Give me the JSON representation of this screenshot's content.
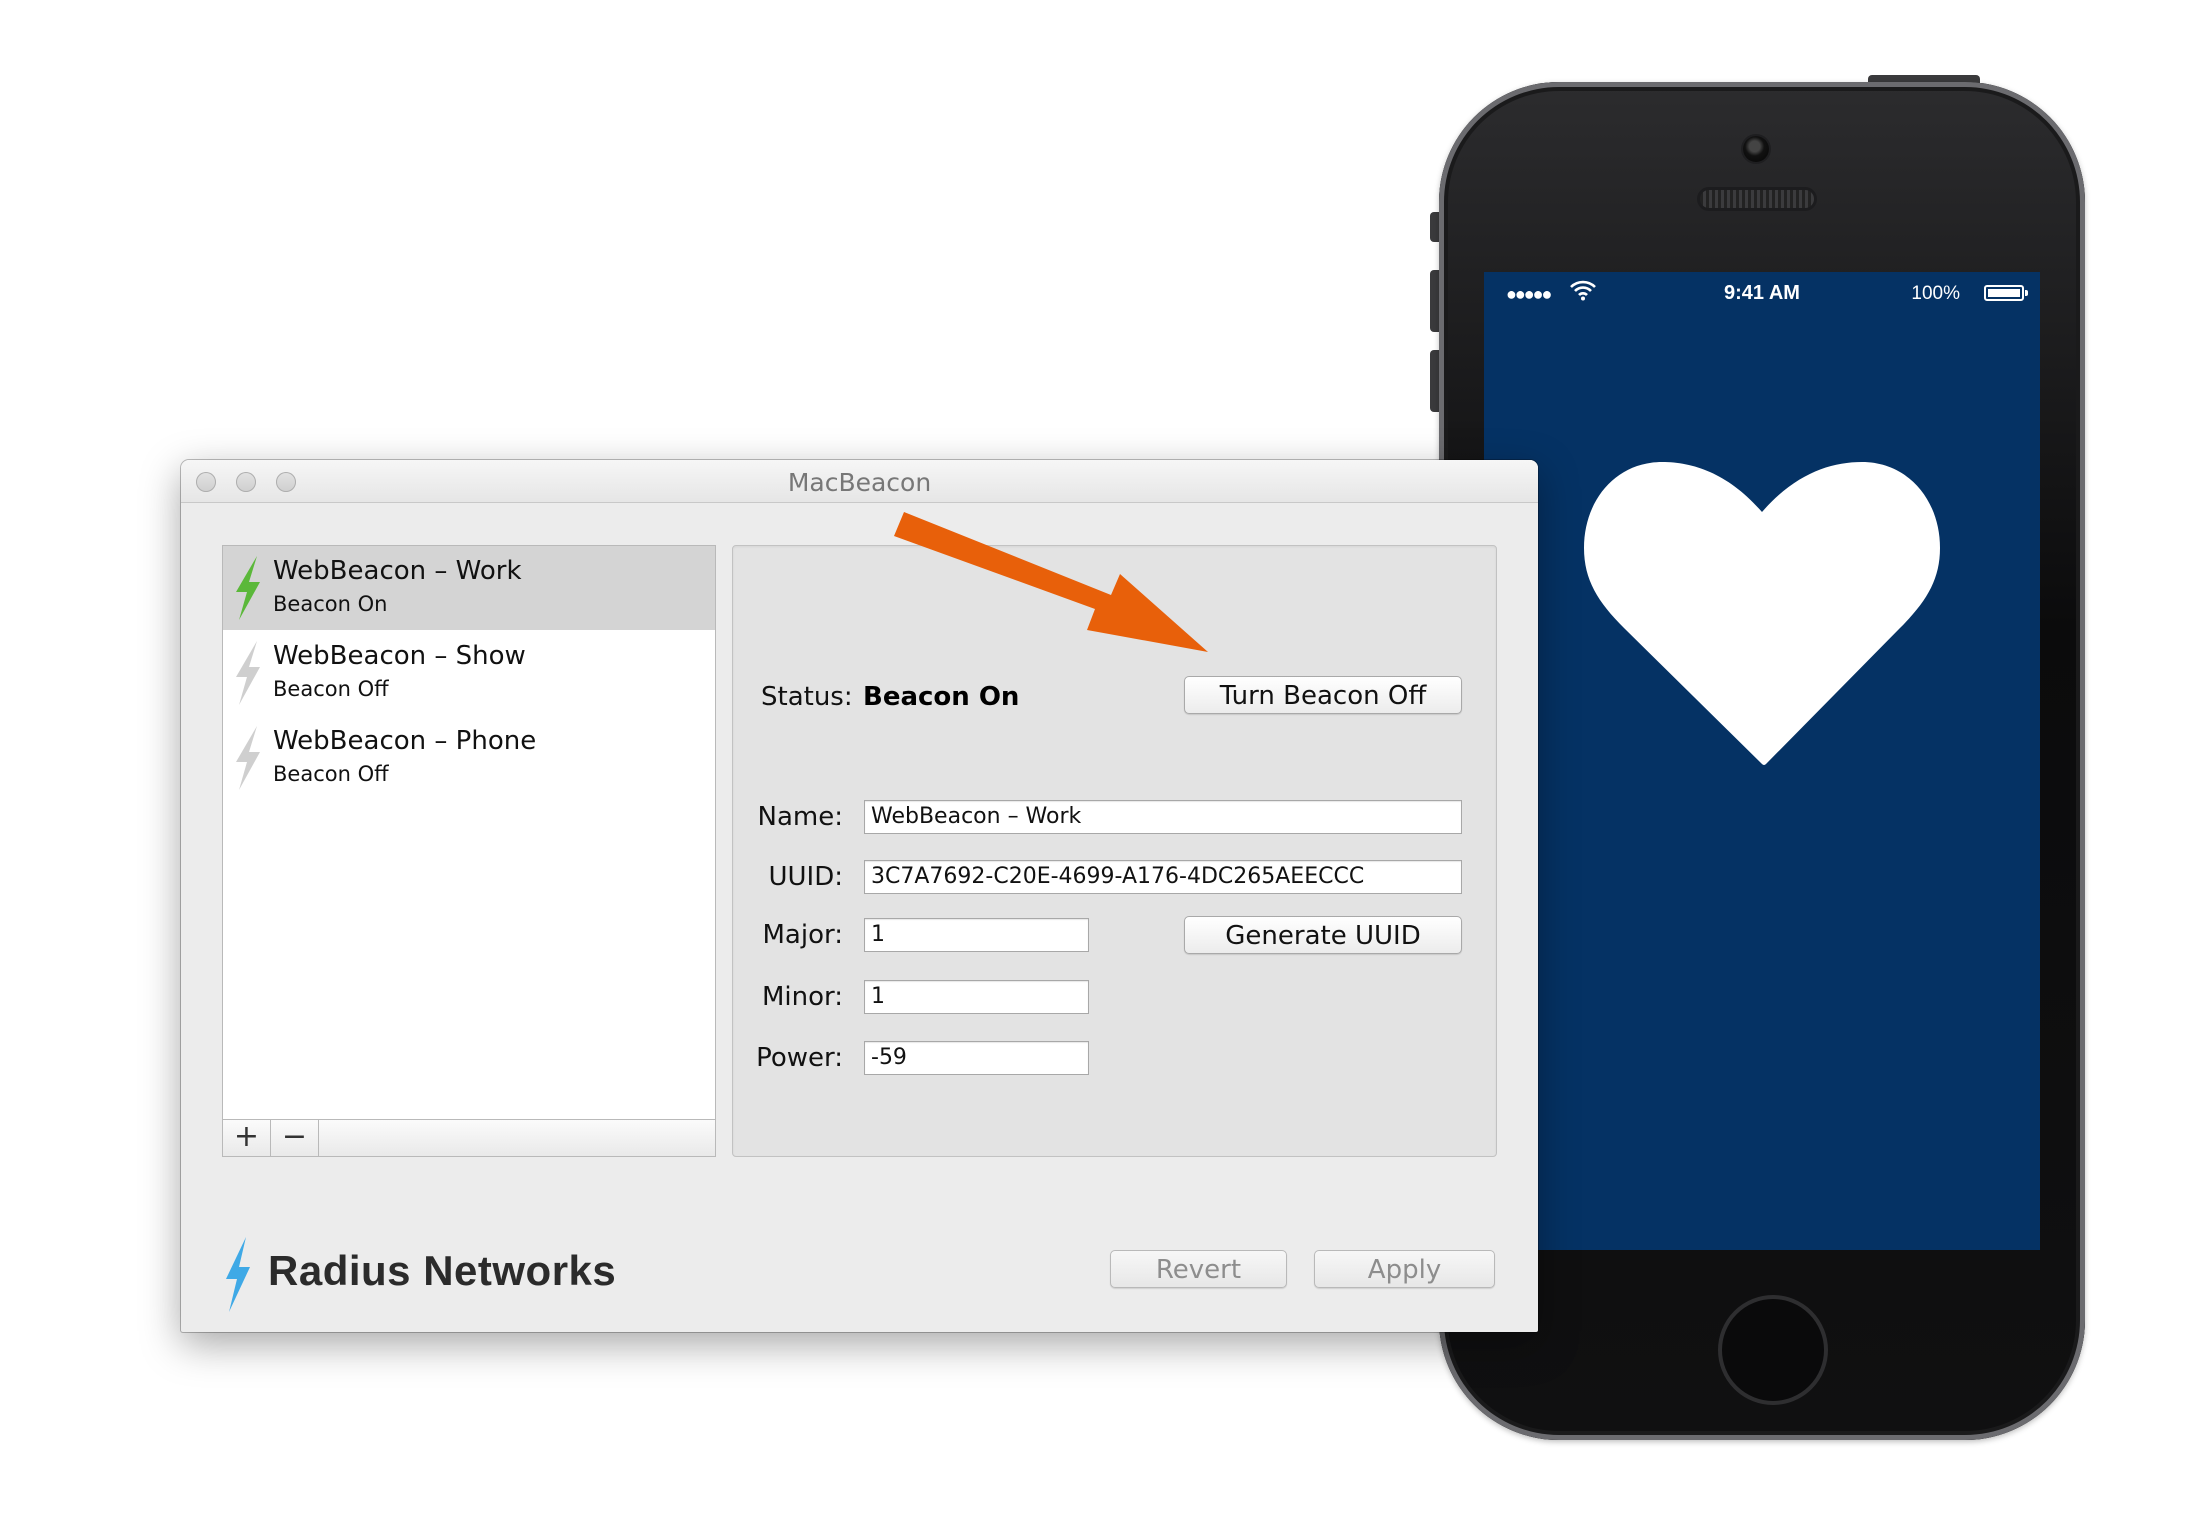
{
  "window": {
    "title": "MacBeacon"
  },
  "beacon_list": {
    "items": [
      {
        "name": "WebBeacon – Work",
        "status": "Beacon On",
        "selected": true,
        "icon": "lightning-bolt-green-icon"
      },
      {
        "name": "WebBeacon – Show",
        "status": "Beacon Off",
        "selected": false,
        "icon": "lightning-bolt-gray-icon"
      },
      {
        "name": "WebBeacon – Phone",
        "status": "Beacon Off",
        "selected": false,
        "icon": "lightning-bolt-gray-icon"
      }
    ],
    "add_label": "+",
    "remove_label": "−"
  },
  "detail": {
    "status_label": "Status:",
    "status_value": "Beacon On",
    "toggle_button": "Turn Beacon Off",
    "name_label": "Name:",
    "name_value": "WebBeacon – Work",
    "uuid_label": "UUID:",
    "uuid_value": "3C7A7692-C20E-4699-A176-4DC265AEECCC",
    "major_label": "Major:",
    "major_value": "1",
    "minor_label": "Minor:",
    "minor_value": "1",
    "power_label": "Power:",
    "power_value": "-59",
    "generate_button": "Generate UUID"
  },
  "footer": {
    "brand": "Radius Networks",
    "revert_button": "Revert",
    "apply_button": "Apply"
  },
  "phone": {
    "time": "9:41 AM",
    "battery": "100%",
    "signal": "●●●●●",
    "screen_color": "#053264",
    "icon": "heart-icon"
  },
  "colors": {
    "arrow": "#e8600a",
    "bolt_on": "#5bb83a",
    "bolt_off": "#cfcfcf",
    "brand_bolt": "#3fa9e6"
  }
}
